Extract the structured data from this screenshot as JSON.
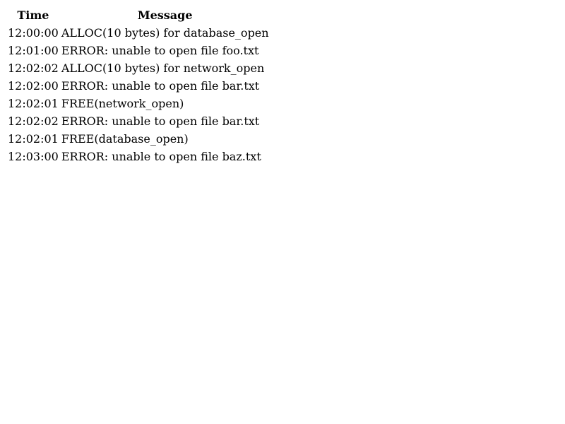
{
  "table": {
    "headers": [
      "Time",
      "Message"
    ],
    "rows": [
      {
        "time": "12:00:00",
        "message": "ALLOC(10 bytes) for database_open"
      },
      {
        "time": "12:01:00",
        "message": "ERROR: unable to open file foo.txt"
      },
      {
        "time": "12:02:02",
        "message": "ALLOC(10 bytes) for network_open"
      },
      {
        "time": "12:02:00",
        "message": "ERROR: unable to open file bar.txt"
      },
      {
        "time": "12:02:01",
        "message": "FREE(network_open)"
      },
      {
        "time": "12:02:02",
        "message": "ERROR: unable to open file bar.txt"
      },
      {
        "time": "12:02:01",
        "message": "FREE(database_open)"
      },
      {
        "time": "12:03:00",
        "message": "ERROR: unable to open file baz.txt"
      }
    ]
  }
}
